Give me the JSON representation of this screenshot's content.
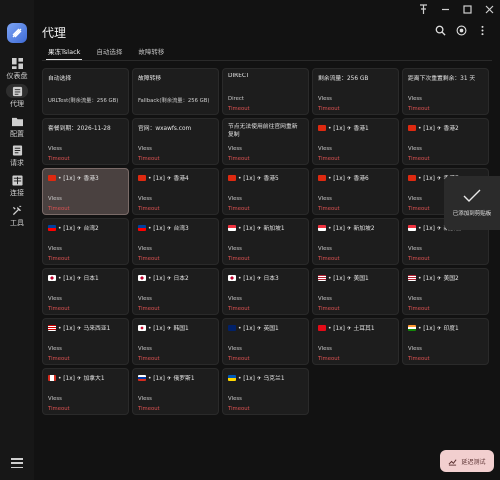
{
  "window": {
    "pin": "〒",
    "minimize": "—",
    "maximize": "□",
    "close": "✕"
  },
  "sidebar": {
    "items": [
      {
        "label": "仪表盘",
        "icon": "dashboard-icon"
      },
      {
        "label": "代理",
        "icon": "proxy-icon"
      },
      {
        "label": "配置",
        "icon": "folder-icon"
      },
      {
        "label": "请求",
        "icon": "request-icon"
      },
      {
        "label": "连接",
        "icon": "connection-icon"
      },
      {
        "label": "工具",
        "icon": "tools-icon"
      }
    ],
    "active_index": 1
  },
  "header": {
    "title": "代理"
  },
  "tabs": [
    "果冻Tslack",
    "自动选择",
    "故障转移"
  ],
  "active_tab": 0,
  "cards": [
    {
      "name": "自动选择",
      "type": "URLTest(剩余流量：256 GB)",
      "status": ""
    },
    {
      "name": "故障转移",
      "type": "Fallback(剩余流量：256 GB)",
      "status": ""
    },
    {
      "name": "DIRECT",
      "type": "Direct",
      "status": "Timeout"
    },
    {
      "name": "剩余流量：256 GB",
      "type": "Vless",
      "status": "Timeout"
    },
    {
      "name": "距离下次重置剩余：31 天",
      "type": "Vless",
      "status": "Timeout"
    },
    {
      "name": "套餐到期：2026-11-28",
      "type": "Vless",
      "status": "Timeout"
    },
    {
      "name": "官网：wxawfs.com",
      "type": "Vless",
      "status": "Timeout"
    },
    {
      "name": "节点无法使用前往官网重新复制",
      "type": "Vless",
      "status": "Timeout",
      "wrap": true
    },
    {
      "name": "• [1x] ✈ 香港1",
      "type": "Vless",
      "status": "Timeout",
      "flag": "hk"
    },
    {
      "name": "• [1x] ✈ 香港2",
      "type": "Vless",
      "status": "Timeout",
      "flag": "hk"
    },
    {
      "name": "• [1x] ✈ 香港3",
      "type": "Vless",
      "status": "Timeout",
      "flag": "hk",
      "selected": true
    },
    {
      "name": "• [1x] ✈ 香港4",
      "type": "Vless",
      "status": "Timeout",
      "flag": "hk"
    },
    {
      "name": "• [1x] ✈ 香港5",
      "type": "Vless",
      "status": "Timeout",
      "flag": "hk"
    },
    {
      "name": "• [1x] ✈ 香港6",
      "type": "Vless",
      "status": "Timeout",
      "flag": "hk"
    },
    {
      "name": "• [1x] ✈ 香港7",
      "type": "Vless",
      "status": "Timeout",
      "flag": "hk"
    },
    {
      "name": "• [1x] ✈ 台湾2",
      "type": "Vless",
      "status": "Timeout",
      "flag": "tw"
    },
    {
      "name": "• [1x] ✈ 台湾3",
      "type": "Vless",
      "status": "Timeout",
      "flag": "tw"
    },
    {
      "name": "• [1x] ✈ 新加坡1",
      "type": "Vless",
      "status": "Timeout",
      "flag": "sg"
    },
    {
      "name": "• [1x] ✈ 新加坡2",
      "type": "Vless",
      "status": "Timeout",
      "flag": "sg"
    },
    {
      "name": "• [1x] ✈ 新加坡3",
      "type": "Vless",
      "status": "Timeout",
      "flag": "sg"
    },
    {
      "name": "• [1x] ✈ 日本1",
      "type": "Vless",
      "status": "Timeout",
      "flag": "jp"
    },
    {
      "name": "• [1x] ✈ 日本2",
      "type": "Vless",
      "status": "Timeout",
      "flag": "jp"
    },
    {
      "name": "• [1x] ✈ 日本3",
      "type": "Vless",
      "status": "Timeout",
      "flag": "jp"
    },
    {
      "name": "• [1x] ✈ 美国1",
      "type": "Vless",
      "status": "Timeout",
      "flag": "us"
    },
    {
      "name": "• [1x] ✈ 美国2",
      "type": "Vless",
      "status": "Timeout",
      "flag": "us"
    },
    {
      "name": "• [1x] ✈ 马来西亚1",
      "type": "Vless",
      "status": "Timeout",
      "flag": "my"
    },
    {
      "name": "• [1x] ✈ 韩国1",
      "type": "Vless",
      "status": "Timeout",
      "flag": "kr"
    },
    {
      "name": "• [1x] ✈ 英国1",
      "type": "Vless",
      "status": "Timeout",
      "flag": "gb"
    },
    {
      "name": "• [1x] ✈ 土耳其1",
      "type": "Vless",
      "status": "Timeout",
      "flag": "tr"
    },
    {
      "name": "• [1x] ✈ 印度1",
      "type": "Vless",
      "status": "Timeout",
      "flag": "in"
    },
    {
      "name": "• [1x] ✈ 加拿大1",
      "type": "Vless",
      "status": "Timeout",
      "flag": "ca"
    },
    {
      "name": "• [1x] ✈ 俄罗斯1",
      "type": "Vless",
      "status": "Timeout",
      "flag": "ru"
    },
    {
      "name": "• [1x] ✈ 乌克兰1",
      "type": "Vless",
      "status": "Timeout",
      "flag": "ua"
    }
  ],
  "toast": {
    "text": "已添加到剪贴板"
  },
  "delay_button": {
    "label": "延迟测试"
  },
  "colors": {
    "timeout": "#e05252",
    "selected_card": "#4a4140",
    "accent": "#6fb6ff"
  }
}
